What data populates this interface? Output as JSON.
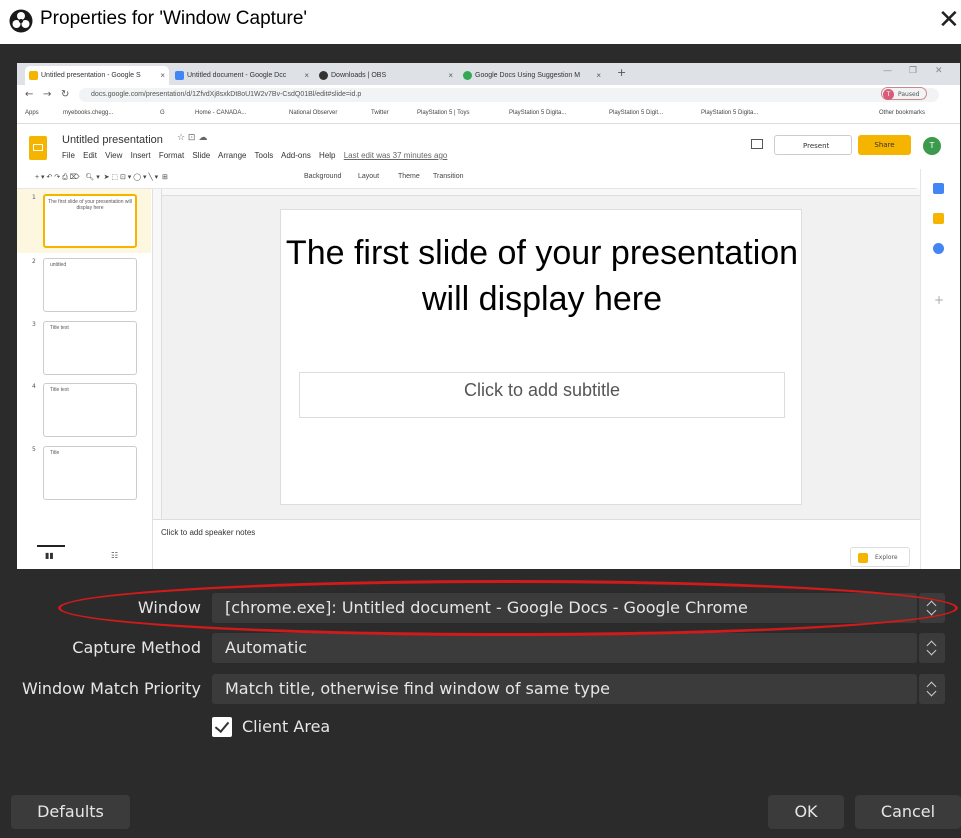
{
  "window": {
    "title": "Properties for 'Window Capture'"
  },
  "preview": {
    "tabs": [
      {
        "label": "Untitled presentation - Google S",
        "color": "#f4b400"
      },
      {
        "label": "Untitled document - Google Dcc",
        "color": "#4285f4"
      },
      {
        "label": "Downloads | OBS",
        "color": "#333333"
      },
      {
        "label": "Google Docs Using Suggestion M",
        "color": "#34a853"
      }
    ],
    "url": "docs.google.com/presentation/d/1ZfvdXj8sxkDt8oU1W2v7Bv-CsdQ01Bl/edit#slide=id.p",
    "profile": {
      "initial": "T",
      "label": "Paused"
    },
    "bookmarks": [
      "Apps",
      "myebooks.chegg...",
      "G",
      "Home - CANADA...",
      "National Observer",
      "Twitter",
      "PlayStation 5 | Toys",
      "PlayStation 5 Digita...",
      "PlayStation 5 Digit...",
      "PlayStation 5 Digita...",
      "Other bookmarks"
    ],
    "doc_title": "Untitled presentation",
    "menu": [
      "File",
      "Edit",
      "View",
      "Insert",
      "Format",
      "Slide",
      "Arrange",
      "Tools",
      "Add-ons",
      "Help"
    ],
    "last_edit": "Last edit was 37 minutes ago",
    "present_label": "Present",
    "share_label": "Share",
    "user_initial": "T",
    "toolbar_items": [
      "Background",
      "Layout",
      "Theme",
      "Transition"
    ],
    "thumbnails": [
      {
        "num": "1",
        "text": "The first slide of your presentation will display here"
      },
      {
        "num": "2",
        "text": "untitled"
      },
      {
        "num": "3",
        "text": "Title text"
      },
      {
        "num": "4",
        "text": "Title text"
      },
      {
        "num": "5",
        "text": "Title"
      }
    ],
    "slide_title": "The first slide of your presentation will display here",
    "slide_subtitle": "Click to add subtitle",
    "speaker_notes": "Click to add speaker notes",
    "explore_label": "Explore"
  },
  "form": {
    "window_label": "Window",
    "window_value": "[chrome.exe]: Untitled document - Google Docs - Google Chrome",
    "capture_label": "Capture Method",
    "capture_value": "Automatic",
    "priority_label": "Window Match Priority",
    "priority_value": "Match title, otherwise find window of same type",
    "client_area_label": "Client Area",
    "client_area_checked": true
  },
  "buttons": {
    "defaults": "Defaults",
    "ok": "OK",
    "cancel": "Cancel"
  },
  "colors": {
    "dialog_bg": "#2b2b2b",
    "field_bg": "#3b3b3b",
    "highlight_ellipse": "#d11a1a",
    "slides_accent": "#f4b400"
  }
}
